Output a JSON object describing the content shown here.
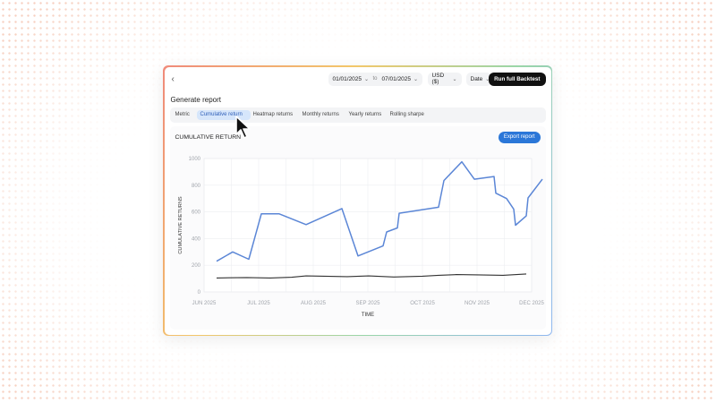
{
  "toolbar": {
    "back_icon": "chevron-left-icon",
    "date_from": "01/01/2025",
    "to_label": "to",
    "date_to": "07/01/2025",
    "currency": "USD ($)",
    "sort_by": "Date",
    "run_label": "Run full Backtest"
  },
  "report": {
    "title": "Generate report",
    "tabs": [
      {
        "label": "Metric"
      },
      {
        "label": "Cumulative return",
        "active": true
      },
      {
        "label": "Heatmap returns"
      },
      {
        "label": "Monthly returns"
      },
      {
        "label": "Yearly returns"
      },
      {
        "label": "Rolling sharpe"
      }
    ],
    "chart_title": "CUMULATIVE RETURN",
    "export_label": "Export report"
  },
  "colors": {
    "accent": "#2b77d8",
    "series_blue": "#5b86d6",
    "series_dark": "#333333"
  },
  "chart_data": {
    "type": "line",
    "xlabel": "TIME",
    "ylabel": "CUMULATIVE RETURNS",
    "x_ticks": [
      "JUN 2025",
      "JUL 2025",
      "AUG 2025",
      "SEP 2025",
      "OCT 2025",
      "NOV 2025",
      "DEC 2025"
    ],
    "y_ticks": [
      0,
      200,
      400,
      600,
      800,
      1000
    ],
    "xlim": [
      "2025-06-01",
      "2025-12-01"
    ],
    "ylim": [
      0,
      1000
    ],
    "grid": true,
    "series": [
      {
        "color": "#5b86d6",
        "points": [
          [
            "2025-06-08",
            230
          ],
          [
            "2025-06-17",
            300
          ],
          [
            "2025-06-26",
            245
          ],
          [
            "2025-07-03",
            585
          ],
          [
            "2025-07-13",
            585
          ],
          [
            "2025-07-28",
            505
          ],
          [
            "2025-08-17",
            625
          ],
          [
            "2025-08-26",
            270
          ],
          [
            "2025-09-09",
            345
          ],
          [
            "2025-09-11",
            450
          ],
          [
            "2025-09-17",
            480
          ],
          [
            "2025-09-18",
            590
          ],
          [
            "2025-10-10",
            635
          ],
          [
            "2025-10-13",
            835
          ],
          [
            "2025-10-23",
            975
          ],
          [
            "2025-10-30",
            845
          ],
          [
            "2025-11-10",
            865
          ],
          [
            "2025-11-11",
            740
          ],
          [
            "2025-11-17",
            700
          ],
          [
            "2025-11-21",
            620
          ],
          [
            "2025-11-22",
            500
          ],
          [
            "2025-11-28",
            570
          ],
          [
            "2025-11-29",
            705
          ],
          [
            "2025-12-07",
            845
          ]
        ]
      },
      {
        "color": "#333333",
        "points": [
          [
            "2025-06-08",
            105
          ],
          [
            "2025-06-25",
            108
          ],
          [
            "2025-07-08",
            105
          ],
          [
            "2025-07-20",
            110
          ],
          [
            "2025-07-28",
            120
          ],
          [
            "2025-08-20",
            115
          ],
          [
            "2025-09-01",
            120
          ],
          [
            "2025-09-15",
            112
          ],
          [
            "2025-10-01",
            118
          ],
          [
            "2025-10-10",
            125
          ],
          [
            "2025-10-20",
            130
          ],
          [
            "2025-11-01",
            128
          ],
          [
            "2025-11-15",
            125
          ],
          [
            "2025-11-28",
            135
          ]
        ]
      }
    ]
  }
}
